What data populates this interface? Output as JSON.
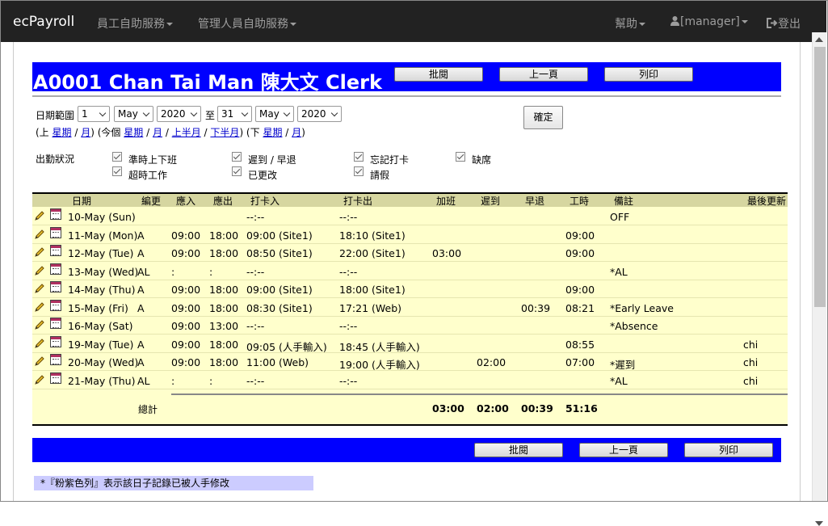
{
  "navbar": {
    "brand": "ecPayroll",
    "employee_menu": "員工自助服務",
    "manager_menu": "管理人員自助服務",
    "help_menu": "幫助",
    "user_menu": "[manager]",
    "logout": "登出"
  },
  "header": {
    "title": "A0001 Chan Tai Man 陳大文 Clerk",
    "approve_label": "批閱",
    "prev_label": "上一頁",
    "print_label": "列印"
  },
  "date_range": {
    "label": "日期範圍",
    "from_day": "1",
    "from_month": "May",
    "from_year": "2020",
    "to_label": "至",
    "to_day": "31",
    "to_month": "May",
    "to_year": "2020",
    "confirm_label": "確定"
  },
  "quick_links": {
    "prev_open": "(上",
    "prev_week": "星期",
    "slash1": "/",
    "prev_month": "月",
    "mid_open": ") (今個",
    "this_week": "星期",
    "slash2": "/",
    "this_month": "月",
    "slash3": "/",
    "first_half": "上半月",
    "slash4": "/",
    "second_half": "下半月",
    "next_open": ") (下",
    "next_week": "星期",
    "slash5": "/",
    "next_month": "月",
    "close": ")"
  },
  "attendance_filter": {
    "label": "出勤狀況",
    "options": [
      "準時上下班",
      "遲到 / 早退",
      "忘記打卡",
      "缺席",
      "超時工作",
      "已更改",
      "請假"
    ]
  },
  "table": {
    "headers": [
      "日期",
      "編更",
      "應入",
      "應出",
      "打卡入",
      "打卡出",
      "加班",
      "遲到",
      "早退",
      "工時",
      "備註",
      "最後更新"
    ],
    "rows": [
      {
        "date": "10-May (Sun)",
        "shift": "",
        "in": "",
        "out": "",
        "clock_in": "--:--",
        "clock_out": "--:--",
        "ot": "",
        "late": "",
        "early": "",
        "hours": "",
        "remark": "OFF",
        "updated": ""
      },
      {
        "date": "11-May (Mon)",
        "shift": "A",
        "in": "09:00",
        "out": "18:00",
        "clock_in": "09:00 (Site1)",
        "clock_out": "18:10 (Site1)",
        "ot": "",
        "late": "",
        "early": "",
        "hours": "09:00",
        "remark": "",
        "updated": ""
      },
      {
        "date": "12-May (Tue)",
        "shift": "A",
        "in": "09:00",
        "out": "18:00",
        "clock_in": "08:50 (Site1)",
        "clock_out": "22:00 (Site1)",
        "ot": "03:00",
        "late": "",
        "early": "",
        "hours": "09:00",
        "remark": "",
        "updated": ""
      },
      {
        "date": "13-May (Wed)",
        "shift": "AL",
        "in": ":",
        "out": ":",
        "clock_in": "--:--",
        "clock_out": "--:--",
        "ot": "",
        "late": "",
        "early": "",
        "hours": "",
        "remark": "*AL",
        "updated": ""
      },
      {
        "date": "14-May (Thu)",
        "shift": "A",
        "in": "09:00",
        "out": "18:00",
        "clock_in": "09:00 (Site1)",
        "clock_out": "18:00 (Site1)",
        "ot": "",
        "late": "",
        "early": "",
        "hours": "09:00",
        "remark": "",
        "updated": ""
      },
      {
        "date": "15-May (Fri)",
        "shift": "A",
        "in": "09:00",
        "out": "18:00",
        "clock_in": "08:30 (Site1)",
        "clock_out": "17:21 (Web)",
        "ot": "",
        "late": "",
        "early": "00:39",
        "hours": "08:21",
        "remark": "*Early Leave",
        "updated": ""
      },
      {
        "date": "16-May (Sat)",
        "shift": "",
        "in": "09:00",
        "out": "13:00",
        "clock_in": "--:--",
        "clock_out": "--:--",
        "ot": "",
        "late": "",
        "early": "",
        "hours": "",
        "remark": "*Absence",
        "updated": ""
      },
      {
        "date": "19-May (Tue)",
        "shift": "A",
        "in": "09:00",
        "out": "18:00",
        "clock_in": "09:05 (人手輸入)",
        "clock_out": "18:45 (人手輸入)",
        "ot": "",
        "late": "",
        "early": "",
        "hours": "08:55",
        "remark": "",
        "updated": "chi"
      },
      {
        "date": "20-May (Wed)",
        "shift": "A",
        "in": "09:00",
        "out": "18:00",
        "clock_in": "11:00 (Web)",
        "clock_out": "19:00 (人手輸入)",
        "ot": "",
        "late": "02:00",
        "early": "",
        "hours": "07:00",
        "remark": "*遲到",
        "updated": "chi"
      },
      {
        "date": "21-May (Thu)",
        "shift": "AL",
        "in": ":",
        "out": ":",
        "clock_in": "--:--",
        "clock_out": "--:--",
        "ot": "",
        "late": "",
        "early": "",
        "hours": "",
        "remark": "*AL",
        "updated": "chi"
      }
    ],
    "totals": {
      "label": "總計",
      "ot": "03:00",
      "late": "02:00",
      "early": "00:39",
      "hours": "51:16"
    }
  },
  "footer_note": "*『粉紫色列』表示該日子記錄已被人手修改",
  "colors": {
    "navbar": "#222222",
    "header_bar": "#0000ff",
    "table_bg": "#ffffcc",
    "table_head": "#d6d6a0",
    "note_bg": "#ccccff"
  }
}
